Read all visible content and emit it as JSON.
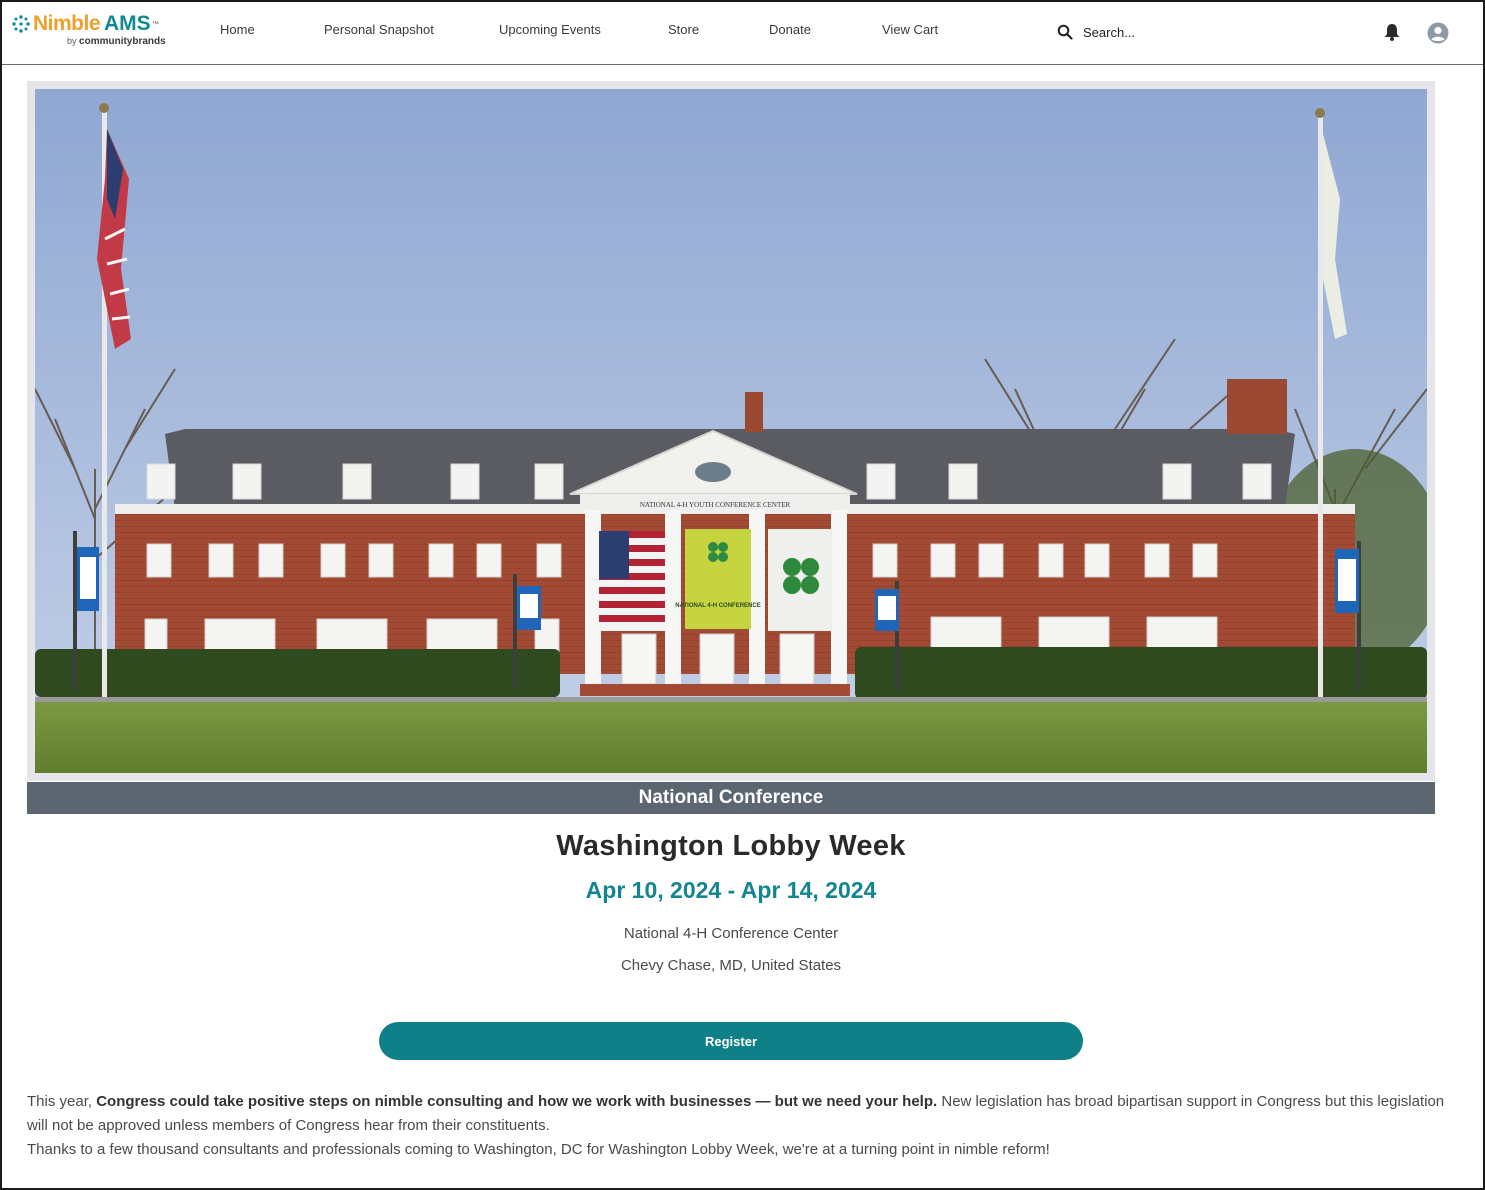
{
  "brand": {
    "name_part1": "Nimble",
    "name_part2": "AMS",
    "trademark": "™",
    "byline_prefix": "by",
    "byline_brand": "communitybrands",
    "colors": {
      "orange": "#f0a02a",
      "teal": "#0f8a94"
    }
  },
  "nav": {
    "items": [
      {
        "label": "Home"
      },
      {
        "label": "Personal Snapshot"
      },
      {
        "label": "Upcoming Events"
      },
      {
        "label": "Store"
      },
      {
        "label": "Donate"
      },
      {
        "label": "View Cart"
      }
    ],
    "search_placeholder": "Search...",
    "icons": [
      "search-icon",
      "bell-icon",
      "user-avatar-icon"
    ]
  },
  "event": {
    "category": "National Conference",
    "title": "Washington Lobby Week",
    "dates": "Apr 10, 2024 - Apr 14, 2024",
    "venue": "National 4-H Conference Center",
    "location": "Chevy Chase, MD, United States",
    "register_label": "Register",
    "image_sign_text": "NATIONAL 4-H YOUTH CONFERENCE CENTER",
    "banner_text": "NATIONAL 4-H CONFERENCE"
  },
  "description": {
    "p1_lead": "This year, ",
    "p1_bold": "Congress could take positive steps on nimble consulting and how we work with businesses — but we need your help.",
    "p1_rest": " New legislation has broad bipartisan support in Congress but this legislation will not be approved unless members of Congress hear from their constituents.",
    "p2": "Thanks to a few thousand consultants and professionals coming to Washington, DC for Washington Lobby Week, we're at a turning point in nimble reform!"
  },
  "colors": {
    "accent": "#0f8088",
    "date_color": "#118590",
    "band": "#5b6670"
  }
}
